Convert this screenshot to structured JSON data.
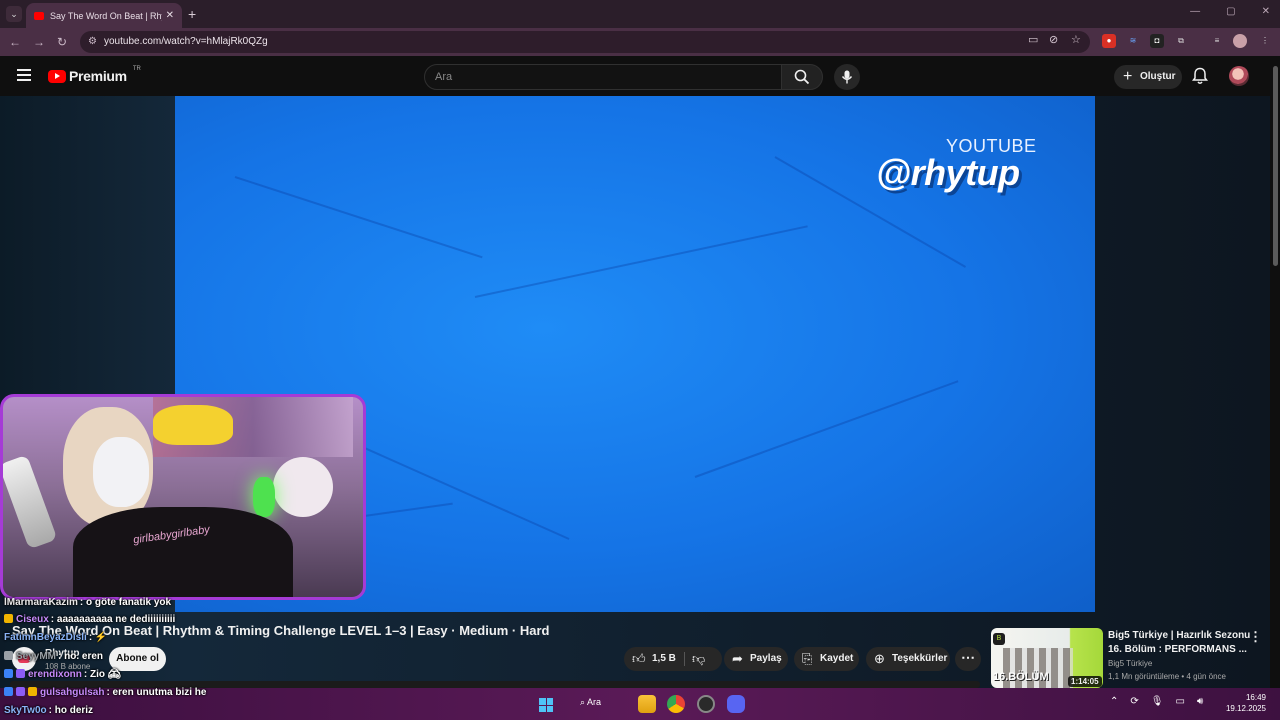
{
  "browser": {
    "tab_title": "Say The Word On Beat | Rhythm",
    "new_tab": "+",
    "url": "youtube.com/watch?v=hMlajRk0QZg",
    "window_controls": [
      "—",
      "▢",
      "✕"
    ]
  },
  "youtube": {
    "logo_word": "Premium",
    "country_code": "TR",
    "search_placeholder": "Ara",
    "create_label": "Oluştur"
  },
  "video": {
    "watermark_top": "YOUTUBE",
    "watermark_handle": "@rhytup",
    "title": "Say The Word On Beat | Rhythm & Timing Challenge LEVEL 1–3 | Easy · Medium · Hard",
    "channel_name": "Rhytup",
    "channel_subs": "108 B abone",
    "subscribe_label": "Abone ol",
    "like_count": "1,5 B",
    "share_label": "Paylaş",
    "save_label": "Kaydet",
    "thanks_label": "Teşekkürler"
  },
  "webcam": {
    "shirt_text": "girlbabygirlbaby"
  },
  "chat": [
    {
      "user": "lMarmaraKazim",
      "message": ": o göte fanatik yok",
      "color": "#ffffff"
    },
    {
      "user": "Ciseux",
      "message": ": aaaaaaaaaa ne dediiiiiiiiii",
      "color": "#c58af9"
    },
    {
      "user": "FatimnBeyazDisli",
      "message": ":",
      "color": "#8ab4f8"
    },
    {
      "user": "SeyyMM",
      "message": ": no. eren",
      "color": "#9aa0a6"
    },
    {
      "user": "erendixonn",
      "message": ": Zio",
      "color": "#c58af9"
    },
    {
      "user": "gulsahgulsah",
      "message": ": eren unutma bizi he",
      "color": "#c58af9"
    },
    {
      "user": "SkyTw0o",
      "message": ": ho deriz",
      "color": "#8ab4f8"
    }
  ],
  "recommendation": {
    "title_line1": "Big5 Türkiye | Hazırlık Sezonu",
    "title_line2": "16. Bölüm : PERFORMANS ...",
    "channel": "Big5 Türkiye",
    "meta": "1,1 Mn görüntüleme • 4 gün önce",
    "duration": "1:14:05",
    "thumb_text": "16.BÖLÜM",
    "thumb_badge": "B"
  },
  "taskbar": {
    "search_label": "Ara",
    "time": "16:49",
    "date": "19.12.2025"
  },
  "colors": {
    "youtube_red": "#ff0000",
    "video_blue": "#1574e6",
    "webcam_border": "#a53bd6",
    "taskbar": "#5a1a57"
  }
}
